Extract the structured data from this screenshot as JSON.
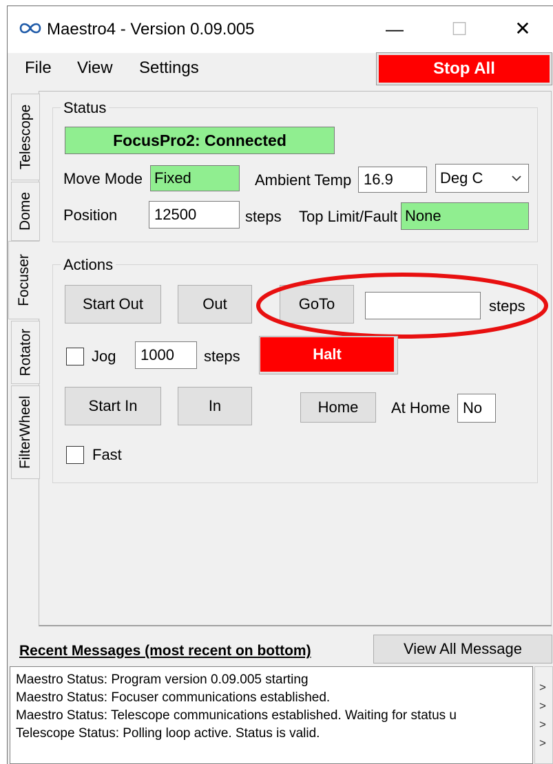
{
  "window": {
    "title": "Maestro4 - Version 0.09.005",
    "app_icon": "infinity-icon",
    "controls": {
      "minimize": "—",
      "maximize": "☐",
      "close": "✕"
    }
  },
  "menu": {
    "file": "File",
    "view": "View",
    "settings": "Settings"
  },
  "stop_all": "Stop All",
  "side_tabs": [
    "Telescope",
    "Dome",
    "Focuser",
    "Rotator",
    "FilterWheel"
  ],
  "status": {
    "group_label": "Status",
    "connection": "FocusPro2: Connected",
    "move_mode_label": "Move Mode",
    "move_mode_value": "Fixed",
    "ambient_temp_label": "Ambient Temp",
    "ambient_temp_value": "16.9",
    "temp_unit": "Deg C",
    "position_label": "Position",
    "position_value": "12500",
    "position_unit": "steps",
    "top_limit_label": "Top Limit/Fault",
    "top_limit_value": "None"
  },
  "actions": {
    "group_label": "Actions",
    "start_out": "Start Out",
    "out": "Out",
    "goto": "GoTo",
    "goto_value": "",
    "goto_unit": "steps",
    "jog_label": "Jog",
    "jog_value": "1000",
    "jog_unit": "steps",
    "halt": "Halt",
    "start_in": "Start In",
    "in": "In",
    "home": "Home",
    "at_home_label": "At Home",
    "at_home_value": "No",
    "fast_label": "Fast"
  },
  "messages": {
    "heading": "Recent Messages (most recent on bottom)",
    "view_all": "View All Message",
    "lines": [
      "Maestro Status: Program version 0.09.005 starting",
      "Maestro Status: Focuser communications established.",
      "Maestro Status: Telescope communications established.  Waiting for status u",
      "Telescope Status: Polling loop active.  Status is valid."
    ],
    "scroll_arrows": [
      ">",
      ">",
      ">",
      ">"
    ]
  },
  "colors": {
    "stop_red": "#ff0000",
    "connected_green": "#90ee90",
    "highlight_ring": "#e81010"
  }
}
